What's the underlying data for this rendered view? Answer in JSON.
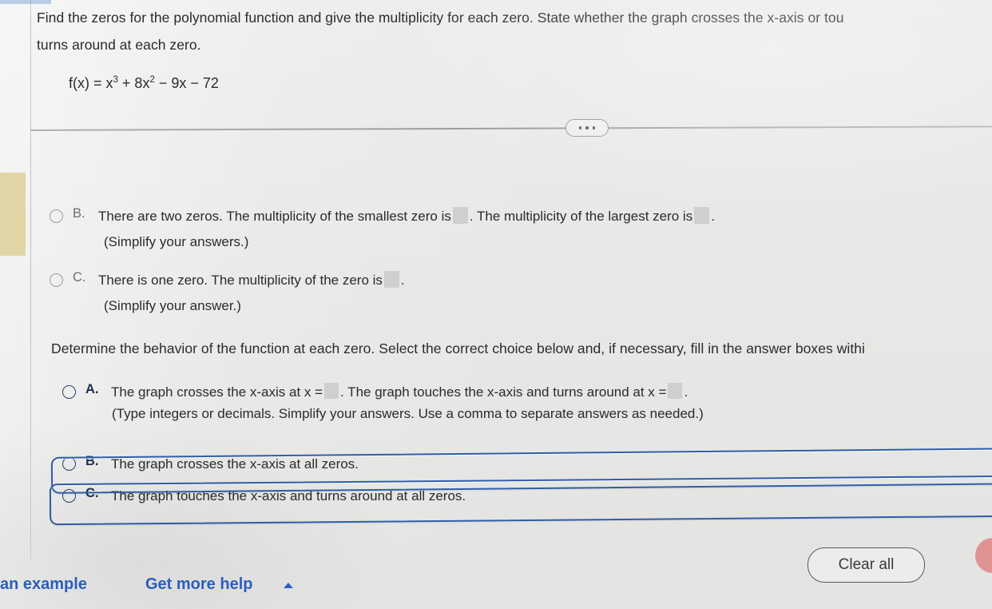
{
  "prompt": {
    "line1": "Find the zeros for the polynomial function and give the multiplicity for each zero.  State whether the graph crosses the x-axis or tou",
    "line2": "turns around at each zero.",
    "formula_prefix": "f(x) = x",
    "formula_exp1": "3",
    "formula_mid": " + 8x",
    "formula_exp2": "2",
    "formula_suffix": " − 9x − 72"
  },
  "divider": {
    "more_icon": "ellipsis-icon",
    "dot1": "",
    "dot2": "",
    "dot3": ""
  },
  "question1": {
    "options": [
      {
        "letter": "B.",
        "text_before": "There are two zeros. The multiplicity of the smallest zero is",
        "text_middle": ". The multiplicity of the largest zero is",
        "text_after": ".",
        "note": "(Simplify your answers.)",
        "box1_value": "",
        "box2_value": ""
      },
      {
        "letter": "C.",
        "text_before": "There is one zero. The multiplicity of the zero is",
        "text_after": ".",
        "note": "(Simplify your answer.)",
        "box1_value": ""
      }
    ]
  },
  "question2": {
    "instruction": "Determine the behavior of the function at each zero. Select the correct choice below and, if necessary, fill in the answer boxes withi",
    "options": [
      {
        "letter": "A.",
        "text_before": "The graph crosses the x-axis at x =",
        "text_middle": ". The graph touches the x-axis and turns around at x =",
        "text_after": ".",
        "note": "(Type integers or decimals. Simplify your answers. Use a comma to separate answers as needed.)",
        "box1_value": "",
        "box2_value": ""
      },
      {
        "letter": "B.",
        "text_before": "The graph crosses the x-axis at all zeros."
      },
      {
        "letter": "C.",
        "text_before": "The graph touches the x-axis and turns around at all zeros."
      }
    ]
  },
  "footer": {
    "clear_all_label": "Clear all",
    "view_example_label": "an example",
    "get_more_help_label": "Get more help",
    "help_caret_icon": "caret-up-icon",
    "avatar_icon": "avatar-circle-icon"
  },
  "colors": {
    "page_background": "#e8e8e6",
    "link_blue": "#2b62c4",
    "highlight_blue": "#2f5ea8",
    "swatch_tan": "#e0d5a4",
    "avatar_pink": "#e09393",
    "answer_box_gray": "#cfcfcf"
  }
}
